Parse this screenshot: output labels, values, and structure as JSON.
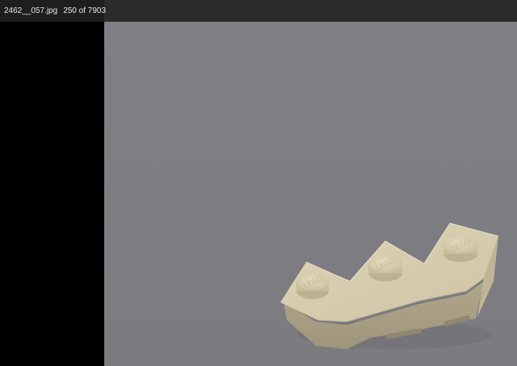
{
  "titlebar": {
    "filename": "2462__057.jpg",
    "position": "250 of 7903"
  },
  "image": {
    "subject": "lego-brick-icon",
    "stud_texts": [
      "LEGO",
      "LEGO",
      "LEGO"
    ],
    "background_color": "#808084",
    "brick_color": "#d8cdb0"
  }
}
